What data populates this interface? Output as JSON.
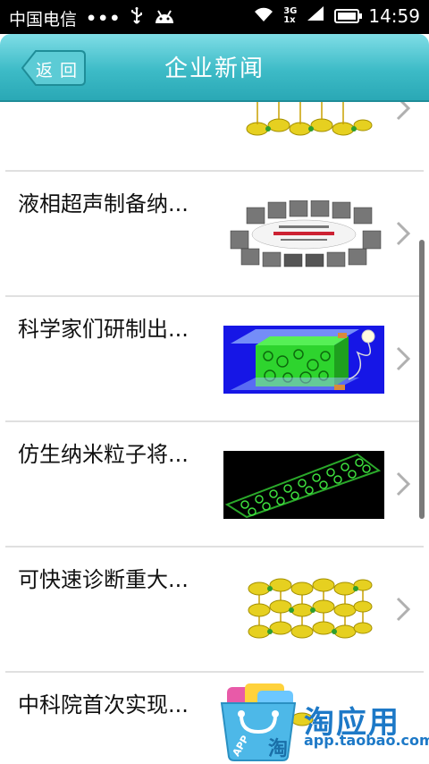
{
  "status_bar": {
    "carrier": "中国电信",
    "dots": "•••",
    "network_top": "3G",
    "network_bottom": "1x",
    "time": "14:59"
  },
  "header": {
    "back_label": "返回",
    "title": "企业新闻"
  },
  "news_items": [
    {
      "title": "",
      "thumbnail": "molecular-lattice"
    },
    {
      "title": "液相超声制备纳...",
      "thumbnail": "nanoparticle-micrograph-collage"
    },
    {
      "title": "科学家们研制出...",
      "thumbnail": "green-foam-cube-lightbulb"
    },
    {
      "title": "仿生纳米粒子将...",
      "thumbnail": "carbon-nanotube"
    },
    {
      "title": "可快速诊断重大...",
      "thumbnail": "molecular-lattice"
    },
    {
      "title": "中科院首次实现...",
      "thumbnail": "molecular-lattice"
    }
  ],
  "watermark": {
    "bag_text": "APP",
    "bag_char": "淘",
    "title": "淘应用",
    "url": "app.taobao.com"
  },
  "colors": {
    "header_top": "#7fdde6",
    "header_bottom": "#2aa8b5",
    "divider": "#e0e0e0",
    "watermark_blue": "#1d79c7"
  }
}
